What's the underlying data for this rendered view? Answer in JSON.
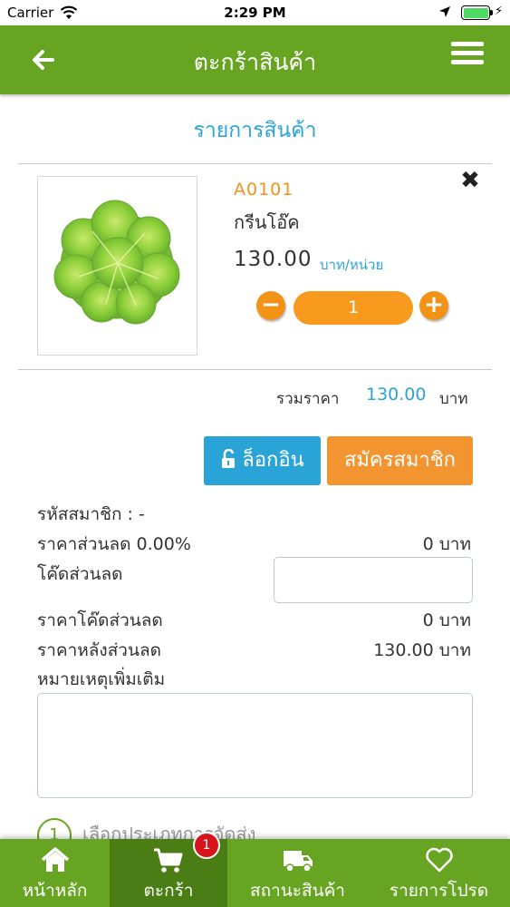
{
  "status_bar": {
    "carrier": "Carrier",
    "time": "2:29 PM"
  },
  "nav": {
    "title": "ตะกร้าสินค้า"
  },
  "section": {
    "title": "รายการสินค้า"
  },
  "product": {
    "code": "A0101",
    "name": "กรีนโอ๊ค",
    "price": "130.00",
    "unit": "บาท/หน่วย",
    "quantity": "1",
    "minus": "−",
    "plus": "+",
    "remove": "✖"
  },
  "totals": {
    "label": "รวมราคา",
    "value": "130.00",
    "unit": "บาท"
  },
  "buttons": {
    "login": "ล็อกอิน",
    "register": "สมัครสมาชิก"
  },
  "summary": {
    "member_code": "รหัสสมาชิก : -",
    "discount_label": "ราคาส่วนลด 0.00%",
    "discount_value": "0 บาท",
    "coupon_label": "โค๊ดส่วนลด",
    "coupon_input_value": "",
    "coupon_discount_label": "ราคาโค๊ดส่วนลด",
    "coupon_discount_value": "0 บาท",
    "after_discount_label": "ราคาหลังส่วนลด",
    "after_discount_value": "130.00 บาท",
    "note_label": "หมายเหตุเพิ่มเติม",
    "note_value": ""
  },
  "step": {
    "number": "1",
    "text": "เลือกประเภทการจัดส่ง"
  },
  "tabs": [
    {
      "label": "หน้าหลัก",
      "icon": "home-icon"
    },
    {
      "label": "ตะกร้า",
      "icon": "cart-icon",
      "badge": "1",
      "active": true
    },
    {
      "label": "สถานะสินค้า",
      "icon": "truck-icon"
    },
    {
      "label": "รายการโปรด",
      "icon": "heart-icon"
    }
  ],
  "colors": {
    "primary": "#67a421",
    "accent_blue": "#2aa3d6",
    "accent_orange": "#f29318",
    "badge": "#d7141a"
  }
}
